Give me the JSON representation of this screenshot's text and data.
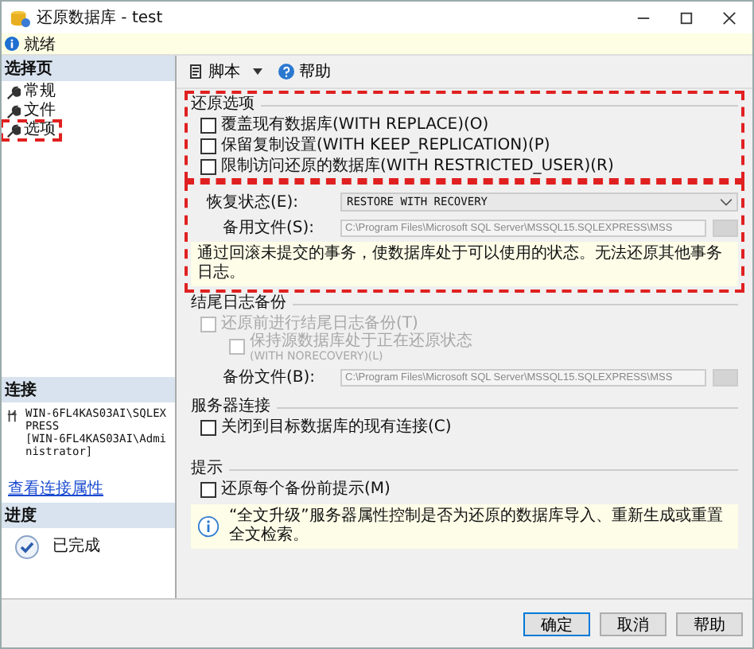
{
  "window": {
    "title": "还原数据库 - test"
  },
  "status": {
    "text": "就绪"
  },
  "sidebar": {
    "header": "选择页",
    "items": [
      {
        "label": "常规",
        "highlighted": false
      },
      {
        "label": "文件",
        "highlighted": false
      },
      {
        "label": "选项",
        "highlighted": true
      }
    ]
  },
  "connection": {
    "header": "连接",
    "server": "WIN-6FL4KAS03AI\\SQLEXPRESS",
    "user": "[WIN-6FL4KAS03AI\\Administrator]",
    "link": "查看连接属性"
  },
  "progress": {
    "header": "进度",
    "status": "已完成"
  },
  "toolbar": [
    {
      "label": "脚本",
      "dropdown": true
    },
    {
      "label": "帮助",
      "dropdown": false
    }
  ],
  "restore_options": {
    "title": "还原选项",
    "highlighted": true,
    "options": [
      {
        "label": "覆盖现有数据库(WITH REPLACE)(O)",
        "checked": false,
        "disabled": false
      },
      {
        "label": "保留复制设置(WITH KEEP_REPLICATION)(P)",
        "checked": false,
        "disabled": false
      },
      {
        "label": "限制访问还原的数据库(WITH RESTRICTED_USER)(R)",
        "checked": false,
        "disabled": false
      }
    ]
  },
  "recovery": {
    "highlighted": true,
    "state_label": "恢复状态(E):",
    "state_value": "RESTORE WITH RECOVERY",
    "standby_label": "备用文件(S):",
    "standby_value": "C:\\Program Files\\Microsoft SQL Server\\MSSQL15.SQLEXPRESS\\MSS",
    "standby_disabled": true,
    "description": "通过回滚未提交的事务，使数据库处于可以使用的状态。无法还原其他事务日志。"
  },
  "tail_log": {
    "title": "结尾日志备份",
    "options": [
      {
        "label": "还原前进行结尾日志备份(T)",
        "checked": false,
        "disabled": true,
        "children": [
          {
            "label": "保持源数据库处于正在还原状态",
            "note": "(WITH NORECOVERY)(L)",
            "checked": false,
            "disabled": true
          }
        ]
      }
    ],
    "backup_label": "备份文件(B):",
    "backup_value": "C:\\Program Files\\Microsoft SQL Server\\MSSQL15.SQLEXPRESS\\MSS",
    "backup_disabled": true
  },
  "server_connections": {
    "title": "服务器连接",
    "options": [
      {
        "label": "关闭到目标数据库的现有连接(C)",
        "checked": false,
        "disabled": false
      }
    ]
  },
  "prompt": {
    "title": "提示",
    "options": [
      {
        "label": "还原每个备份前提示(M)",
        "checked": false,
        "disabled": false
      }
    ],
    "info": "“全文升级”服务器属性控制是否为还原的数据库导入、重新生成或重置全文检索。"
  },
  "buttons": [
    {
      "label": "确定",
      "default": true
    },
    {
      "label": "取消",
      "default": false
    },
    {
      "label": "帮助",
      "default": false
    }
  ]
}
